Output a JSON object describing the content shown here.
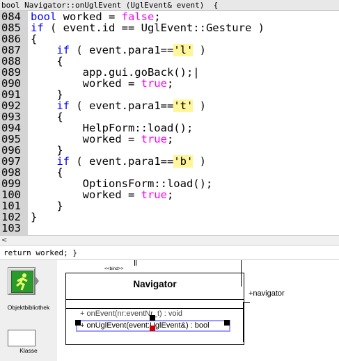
{
  "signature_bar": "bool Navigator::onUglEvent (UglEvent& event)  {",
  "code_lines": [
    {
      "num": "084",
      "segments": [
        {
          "t": "bool",
          "c": "kw"
        },
        {
          "t": " worked = "
        },
        {
          "t": "false",
          "c": "val"
        },
        {
          "t": ";"
        }
      ]
    },
    {
      "num": "085",
      "segments": [
        {
          "t": "if",
          "c": "kw"
        },
        {
          "t": " ( event.id == UglEvent::Gesture )"
        }
      ]
    },
    {
      "num": "086",
      "segments": [
        {
          "t": "{"
        }
      ]
    },
    {
      "num": "087",
      "segments": [
        {
          "t": "    "
        },
        {
          "t": "if",
          "c": "kw"
        },
        {
          "t": " ( event.para1=="
        },
        {
          "t": "'l'",
          "c": "hl"
        },
        {
          "t": " )"
        }
      ]
    },
    {
      "num": "088",
      "segments": [
        {
          "t": "    {"
        }
      ]
    },
    {
      "num": "089",
      "segments": [
        {
          "t": "        app.gui.goBack();|"
        }
      ]
    },
    {
      "num": "090",
      "segments": [
        {
          "t": "        worked = "
        },
        {
          "t": "true",
          "c": "val"
        },
        {
          "t": ";"
        }
      ]
    },
    {
      "num": "091",
      "segments": [
        {
          "t": "    }"
        }
      ]
    },
    {
      "num": "092",
      "segments": [
        {
          "t": "    "
        },
        {
          "t": "if",
          "c": "kw"
        },
        {
          "t": " ( event.para1=="
        },
        {
          "t": "'t'",
          "c": "hl"
        },
        {
          "t": " )"
        }
      ]
    },
    {
      "num": "093",
      "segments": [
        {
          "t": "    {"
        }
      ]
    },
    {
      "num": "094",
      "segments": [
        {
          "t": "        HelpForm::load();"
        }
      ]
    },
    {
      "num": "095",
      "segments": [
        {
          "t": "        worked = "
        },
        {
          "t": "true",
          "c": "val"
        },
        {
          "t": ";"
        }
      ]
    },
    {
      "num": "096",
      "segments": [
        {
          "t": "    }"
        }
      ]
    },
    {
      "num": "097",
      "segments": [
        {
          "t": "    "
        },
        {
          "t": "if",
          "c": "kw"
        },
        {
          "t": " ( event.para1=="
        },
        {
          "t": "'b'",
          "c": "hl"
        },
        {
          "t": " )"
        }
      ]
    },
    {
      "num": "098",
      "segments": [
        {
          "t": "    {"
        }
      ]
    },
    {
      "num": "099",
      "segments": [
        {
          "t": "        OptionsForm::load();"
        }
      ]
    },
    {
      "num": "100",
      "segments": [
        {
          "t": "        worked = "
        },
        {
          "t": "true",
          "c": "val"
        },
        {
          "t": ";"
        }
      ]
    },
    {
      "num": "101",
      "segments": [
        {
          "t": "    }"
        }
      ]
    },
    {
      "num": "102",
      "segments": [
        {
          "t": "}"
        }
      ]
    },
    {
      "num": "103",
      "segments": []
    }
  ],
  "return_bar": "return worked; }",
  "toolbox": {
    "tool1_label": "Objektbibliothek",
    "tool2_label": "Klasse"
  },
  "uml": {
    "stereotype": "<<bind>>",
    "class_name": "Navigator",
    "operations": [
      "+ onEvent(nr:eventNr_t) : void",
      "+ onUglEvent(event:UglEvent&) : bool"
    ],
    "association_label": "+navigator"
  },
  "colors": {
    "keyword": "#0000ff",
    "literal": "#ff00ff",
    "char_highlight": "#fff59a",
    "gutter": "#d4d4d4",
    "tool_icon": "#2a9a2a"
  },
  "icons": {
    "objektbibliothek": "running-figure-icon",
    "scroll_left": "scroll-left-arrow-icon"
  }
}
